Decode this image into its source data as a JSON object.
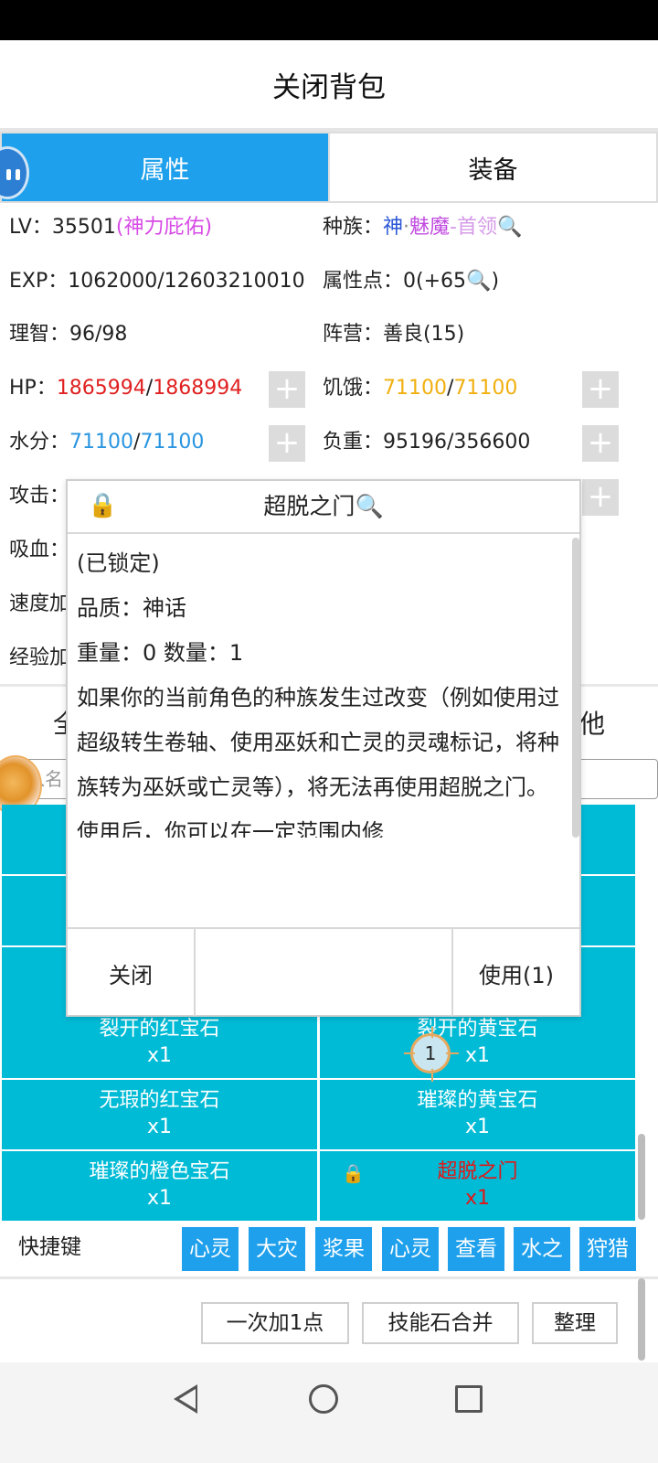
{
  "header": {
    "title": "关闭背包"
  },
  "tabs": [
    {
      "label": "属性"
    },
    {
      "label": "装备"
    }
  ],
  "stats": {
    "lv_label": "LV：",
    "lv_value": "35501",
    "lv_bonus": "(神力庇佑)",
    "race_label": "种族：",
    "race_part1": "神",
    "race_part2": "·",
    "race_part3": "魅魔",
    "race_part4": "-首领",
    "exp_label": "EXP：",
    "exp_value": "1062000/12603210010",
    "attr_label": "属性点：",
    "attr_value": "0(+65",
    "sanity_label": "理智：",
    "sanity_value": "96/98",
    "camp_label": "阵营：",
    "camp_value": "善良(15)",
    "hp_label": "HP：",
    "hp_cur": "1865994",
    "hp_sep": "/",
    "hp_max": "1868994",
    "hunger_label": "饥饿：",
    "hunger_cur": "71100",
    "hunger_sep": "/",
    "hunger_max": "71100",
    "water_label": "水分：",
    "water_cur": "71100",
    "water_sep": "/",
    "water_max": "71100",
    "load_label": "负重：",
    "load_value": "95196/356600",
    "attack_label": "攻击：",
    "lifesteal_label": "吸血：",
    "speed_label": "速度加",
    "expbonus_label": "经验加"
  },
  "behind": {
    "left_text": "全",
    "right_text": "他",
    "search_placeholder": "入名"
  },
  "plus_label": "+",
  "grid": [
    {
      "name": "",
      "count": ""
    },
    {
      "name": "",
      "count": ""
    },
    {
      "name": "",
      "count": ""
    },
    {
      "name": "",
      "count": ""
    },
    {
      "name": "",
      "count": ""
    },
    {
      "name": "",
      "count": ""
    },
    {
      "name": "裂开的红宝石",
      "count": "x1"
    },
    {
      "name": "裂开的黄宝石",
      "count": "x1"
    },
    {
      "name": "无瑕的红宝石",
      "count": "x1"
    },
    {
      "name": "璀璨的黄宝石",
      "count": "x1"
    },
    {
      "name": "璀璨的橙色宝石",
      "count": "x1"
    },
    {
      "name": "超脱之门",
      "count": "x1"
    }
  ],
  "badge": {
    "value": "1"
  },
  "shortcuts": {
    "label": "快捷键",
    "items": [
      "心灵",
      "大灾",
      "浆果",
      "心灵",
      "查看",
      "水之",
      "狩猎"
    ]
  },
  "bottom_buttons": [
    "一次加1点",
    "技能石合并",
    "整理"
  ],
  "modal": {
    "title": "超脱之门",
    "lines": [
      "(已锁定)",
      "品质：神话",
      "重量：0  数量：1"
    ],
    "description": "如果你的当前角色的种族发生过改变（例如使用过超级转生卷轴、使用巫妖和亡灵的灵魂标记，将种族转为巫妖或亡灵等），将无法再使用超脱之门。使用后，你可以在一定范围内修",
    "close_label": "关闭",
    "use_label": "使用(1)"
  },
  "colors": {
    "accent": "#1ea0ec",
    "grid_cell": "#00bbd6",
    "hp": "#e02020",
    "hunger": "#f1b010",
    "water": "#2a95e0",
    "bonus": "#d74ae6"
  }
}
